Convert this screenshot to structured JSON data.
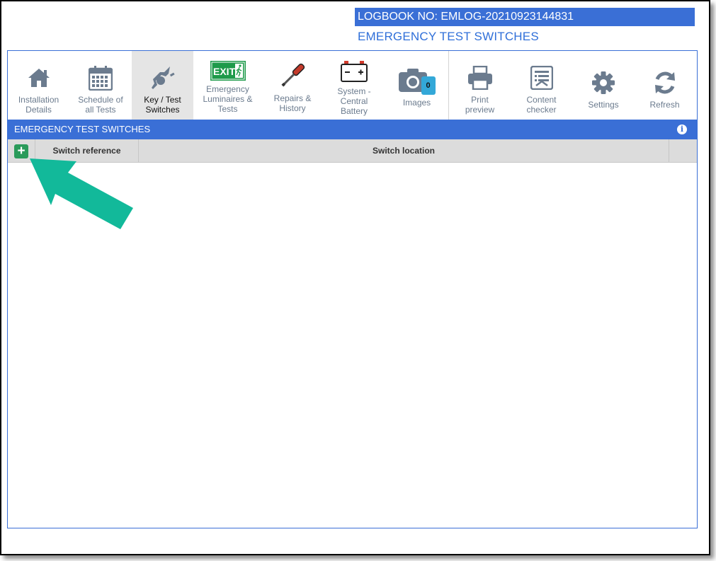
{
  "header": {
    "logbook": "LOGBOOK NO: EMLOG-20210923144831",
    "title": "EMERGENCY TEST SWITCHES"
  },
  "toolbar": {
    "items": [
      {
        "label": "Installation\nDetails",
        "icon": "home-icon"
      },
      {
        "label": "Schedule of\nall Tests",
        "icon": "calendar-icon"
      },
      {
        "label": "Key / Test\nSwitches",
        "icon": "key-switch-icon",
        "active": true
      },
      {
        "label": "Emergency\nLuminaires &\nTests",
        "icon": "exit-sign-icon"
      },
      {
        "label": "Repairs &\nHistory",
        "icon": "screwdriver-icon"
      },
      {
        "label": "System -\nCentral\nBattery",
        "icon": "battery-icon"
      },
      {
        "label": "Images",
        "icon": "camera-icon",
        "badge": "0"
      },
      {
        "label": "Print\npreview",
        "icon": "printer-icon"
      },
      {
        "label": "Content\nchecker",
        "icon": "checklist-icon"
      },
      {
        "label": "Settings",
        "icon": "gear-icon"
      },
      {
        "label": "Refresh",
        "icon": "refresh-icon"
      }
    ],
    "exit_text": "EXIT"
  },
  "section": {
    "title": "EMERGENCY TEST SWITCHES",
    "info_glyph": "i"
  },
  "table": {
    "add_glyph": "+",
    "columns": [
      "Switch reference",
      "Switch location"
    ]
  },
  "colors": {
    "brand_blue": "#3a6fd6",
    "add_green": "#2a9b5a",
    "arrow_teal": "#12b99a"
  }
}
